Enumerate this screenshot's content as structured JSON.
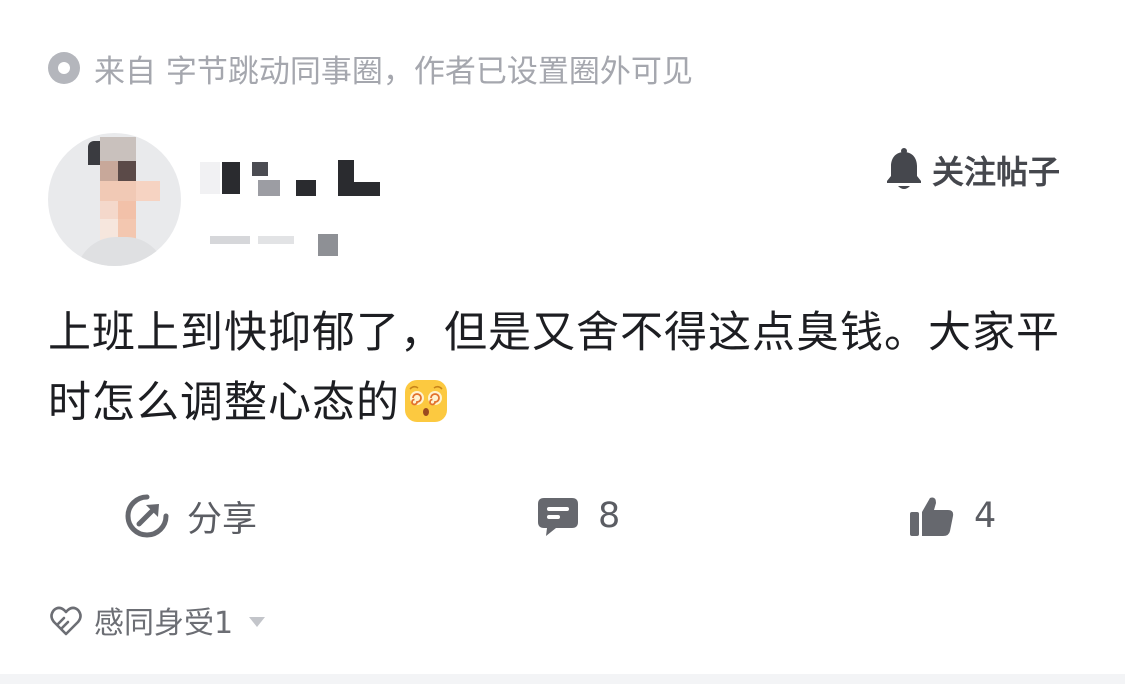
{
  "source": {
    "text": "来自 字节跳动同事圈，作者已设置圈外可见",
    "icon": "circle-dot-icon"
  },
  "author": {
    "avatar": "avatar-icon",
    "name_obscured": true,
    "subtitle_obscured": true
  },
  "follow": {
    "label": "关注帖子",
    "icon": "bell-icon"
  },
  "post": {
    "text": "上班上到快抑郁了，但是又舍不得这点臭钱。大家平时怎么调整心态的",
    "emoji": "dizzy-face-emoji"
  },
  "actions": {
    "share": {
      "label": "分享",
      "icon": "share-icon"
    },
    "comment": {
      "count": "8",
      "icon": "comment-icon"
    },
    "like": {
      "count": "4",
      "icon": "thumbs-up-icon"
    }
  },
  "reactions": {
    "label": "感同身受1",
    "icon": "hug-icon"
  },
  "colors": {
    "text_primary": "#1d1e22",
    "text_secondary": "#a5a7ae",
    "icon_gray": "#66686e"
  }
}
